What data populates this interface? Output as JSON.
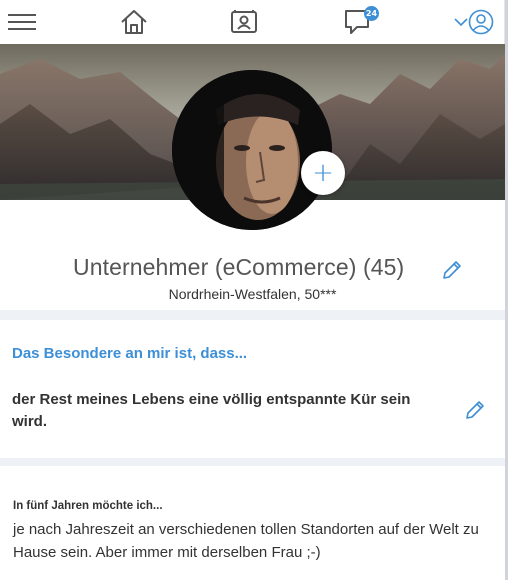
{
  "nav": {
    "message_badge": "24",
    "icons": [
      "hamburger-menu-icon",
      "home-icon",
      "contact-card-icon",
      "chat-bubble-icon",
      "chevron-down-icon",
      "user-circle-icon"
    ]
  },
  "profile": {
    "title": "Unternehmer (eCommerce) (45)",
    "location": "Nordrhein-Westfalen, 50***"
  },
  "special": {
    "heading": "Das Besondere an mir ist, dass...",
    "text": "der Rest meines Lebens eine völlig entspannte Kür sein wird."
  },
  "future": {
    "heading": "In fünf Jahren möchte ich...",
    "text": "je nach Jahreszeit an verschiedenen tollen Standorten auf der Welt zu Hause sein. Aber immer mit derselben Frau ;-)"
  },
  "colors": {
    "accent": "#3d8fd6",
    "background": "#eef1f6"
  }
}
